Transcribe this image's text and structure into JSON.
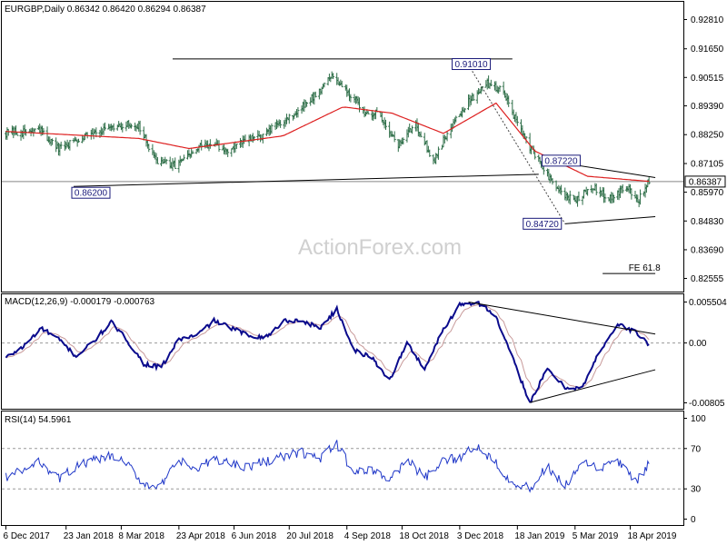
{
  "colors": {
    "price_bar": "#2f6f49",
    "ma": "#dd1f1f",
    "macd": "#0a0a8c",
    "signal": "#c89a9a",
    "rsi": "#1f37c8",
    "trendline": "#000000",
    "ref_dotted": "#888888",
    "grid": "#999999",
    "current_label_bg": "#ffffff"
  },
  "watermark": "ActionForex.com",
  "chart_data": [
    {
      "type": "candlestick",
      "header": "EURGBP,Daily  0.86342 0.86420 0.86294 0.86387",
      "y_ticks": [
        "0.92810",
        "0.91650",
        "0.90515",
        "0.89390",
        "0.88250",
        "0.87105",
        "0.85970",
        "0.84830",
        "0.83690",
        "0.82555"
      ],
      "current_price_label": "0.86387",
      "annotations": [
        {
          "text": "0.86200",
          "x": "2018-01-29",
          "price": 0.862
        },
        {
          "text": "0.91010",
          "x": "2018-12-10",
          "price": 0.9101
        },
        {
          "text": "0.87220",
          "x": "2019-02-11",
          "price": 0.8722
        },
        {
          "text": "0.84720",
          "x": "2019-02-25",
          "price": 0.8472
        },
        {
          "text": "FE 61.8",
          "x": "2019-04-08",
          "price": 0.8275
        }
      ],
      "anchor_points": [
        [
          "2017-12-06",
          0.8832
        ],
        [
          "2017-12-20",
          0.8835
        ],
        [
          "2018-01-03",
          0.884
        ],
        [
          "2018-01-17",
          0.8765
        ],
        [
          "2018-01-31",
          0.8805
        ],
        [
          "2018-02-14",
          0.884
        ],
        [
          "2018-02-28",
          0.8845
        ],
        [
          "2018-03-12",
          0.8865
        ],
        [
          "2018-03-22",
          0.886
        ],
        [
          "2018-04-03",
          0.873
        ],
        [
          "2018-04-18",
          0.87
        ],
        [
          "2018-04-30",
          0.8735
        ],
        [
          "2018-05-14",
          0.879
        ],
        [
          "2018-06-01",
          0.876
        ],
        [
          "2018-06-15",
          0.88
        ],
        [
          "2018-06-29",
          0.882
        ],
        [
          "2018-07-13",
          0.8875
        ],
        [
          "2018-07-27",
          0.8915
        ],
        [
          "2018-08-10",
          0.8985
        ],
        [
          "2018-08-24",
          0.906
        ],
        [
          "2018-09-03",
          0.9005
        ],
        [
          "2018-09-17",
          0.892
        ],
        [
          "2018-10-01",
          0.89
        ],
        [
          "2018-10-15",
          0.878
        ],
        [
          "2018-10-29",
          0.887
        ],
        [
          "2018-11-12",
          0.872
        ],
        [
          "2018-11-26",
          0.886
        ],
        [
          "2018-12-10",
          0.8955
        ],
        [
          "2018-12-24",
          0.903
        ],
        [
          "2019-01-07",
          0.9
        ],
        [
          "2019-01-21",
          0.8835
        ],
        [
          "2019-02-04",
          0.872
        ],
        [
          "2019-02-18",
          0.861
        ],
        [
          "2019-03-04",
          0.856
        ],
        [
          "2019-03-18",
          0.862
        ],
        [
          "2019-04-01",
          0.8575
        ],
        [
          "2019-04-15",
          0.862
        ],
        [
          "2019-04-24",
          0.856
        ],
        [
          "2019-05-03",
          0.8639
        ]
      ],
      "moving_average_anchors": [
        [
          "2017-12-06",
          0.8838
        ],
        [
          "2018-03-22",
          0.881
        ],
        [
          "2018-05-01",
          0.877
        ],
        [
          "2018-07-15",
          0.882
        ],
        [
          "2018-09-01",
          0.8935
        ],
        [
          "2018-10-10",
          0.891
        ],
        [
          "2018-11-20",
          0.883
        ],
        [
          "2019-01-01",
          0.895
        ],
        [
          "2019-02-01",
          0.876
        ],
        [
          "2019-03-15",
          0.866
        ],
        [
          "2019-05-03",
          0.864
        ]
      ],
      "trendlines": [
        {
          "from": [
            "2018-04-18",
            0.9125
          ],
          "to": [
            "2019-01-14",
            0.9125
          ]
        },
        {
          "from": [
            "2018-01-29",
            0.862
          ],
          "to": [
            "2019-02-04",
            0.8668
          ]
        },
        {
          "from": [
            "2019-02-11",
            0.8722
          ],
          "to": [
            "2019-05-08",
            0.8655
          ]
        },
        {
          "from": [
            "2019-02-25",
            0.8472
          ],
          "to": [
            "2019-05-08",
            0.85
          ]
        },
        {
          "from": [
            "2019-03-27",
            0.8275
          ],
          "to": [
            "2019-05-08",
            0.8275
          ]
        }
      ],
      "dotted_lines": [
        {
          "from": [
            "2018-12-10",
            0.9101
          ],
          "to": [
            "2019-02-25",
            0.8472
          ]
        },
        {
          "from": [
            "2017-12-01",
            0.8639
          ],
          "to": [
            "2019-05-08",
            0.8639
          ]
        }
      ]
    },
    {
      "type": "line",
      "header": "MACD(12,26,9) -0.000179 -0.000763",
      "y_ticks": [
        "0.005504",
        "0.00",
        "-0.00805"
      ],
      "macd_anchors": [
        [
          "2017-12-06",
          -0.002
        ],
        [
          "2017-12-20",
          -0.0005
        ],
        [
          "2018-01-03",
          0.002
        ],
        [
          "2018-01-17",
          0.0005
        ],
        [
          "2018-01-31",
          -0.0018
        ],
        [
          "2018-02-14",
          0.0002
        ],
        [
          "2018-02-28",
          0.0028
        ],
        [
          "2018-03-12",
          0.0005
        ],
        [
          "2018-03-26",
          -0.0028
        ],
        [
          "2018-04-09",
          -0.0033
        ],
        [
          "2018-04-23",
          0.0005
        ],
        [
          "2018-05-07",
          0.001
        ],
        [
          "2018-05-21",
          0.003
        ],
        [
          "2018-06-04",
          0.002
        ],
        [
          "2018-06-18",
          0.001
        ],
        [
          "2018-07-02",
          0.0008
        ],
        [
          "2018-07-16",
          0.003
        ],
        [
          "2018-07-30",
          0.003
        ],
        [
          "2018-08-13",
          0.002
        ],
        [
          "2018-08-27",
          0.0045
        ],
        [
          "2018-09-10",
          -0.001
        ],
        [
          "2018-09-24",
          -0.002
        ],
        [
          "2018-10-08",
          -0.005
        ],
        [
          "2018-10-22",
          0.0
        ],
        [
          "2018-11-05",
          -0.0035
        ],
        [
          "2018-11-19",
          0.0015
        ],
        [
          "2018-12-03",
          0.0052
        ],
        [
          "2018-12-17",
          0.0055
        ],
        [
          "2018-12-31",
          0.0038
        ],
        [
          "2019-01-14",
          -0.002
        ],
        [
          "2019-01-28",
          -0.008
        ],
        [
          "2019-02-11",
          -0.0035
        ],
        [
          "2019-02-25",
          -0.006
        ],
        [
          "2019-03-11",
          -0.006
        ],
        [
          "2019-03-25",
          -0.001
        ],
        [
          "2019-04-08",
          0.0025
        ],
        [
          "2019-04-22",
          0.0015
        ],
        [
          "2019-05-03",
          -0.0002
        ]
      ],
      "trendlines": [
        {
          "from": [
            "2018-12-10",
            0.0055
          ],
          "to": [
            "2019-05-08",
            0.0012
          ]
        },
        {
          "from": [
            "2019-01-28",
            -0.008
          ],
          "to": [
            "2019-05-08",
            -0.0036
          ]
        }
      ]
    },
    {
      "type": "line",
      "header": "RSI(14) 54.5961",
      "y_ticks": [
        "100",
        "70",
        "30",
        "0"
      ],
      "levels": [
        70,
        30
      ],
      "rsi_anchors": [
        [
          "2017-12-06",
          42
        ],
        [
          "2017-12-20",
          48
        ],
        [
          "2018-01-03",
          57
        ],
        [
          "2018-01-17",
          40
        ],
        [
          "2018-01-31",
          52
        ],
        [
          "2018-02-14",
          58
        ],
        [
          "2018-02-28",
          62
        ],
        [
          "2018-03-12",
          55
        ],
        [
          "2018-03-26",
          35
        ],
        [
          "2018-04-09",
          33
        ],
        [
          "2018-04-23",
          58
        ],
        [
          "2018-05-07",
          48
        ],
        [
          "2018-05-21",
          60
        ],
        [
          "2018-06-04",
          55
        ],
        [
          "2018-06-18",
          52
        ],
        [
          "2018-07-02",
          58
        ],
        [
          "2018-07-16",
          62
        ],
        [
          "2018-07-30",
          66
        ],
        [
          "2018-08-13",
          60
        ],
        [
          "2018-08-27",
          74
        ],
        [
          "2018-09-10",
          45
        ],
        [
          "2018-09-24",
          50
        ],
        [
          "2018-10-08",
          38
        ],
        [
          "2018-10-22",
          60
        ],
        [
          "2018-11-05",
          40
        ],
        [
          "2018-11-19",
          56
        ],
        [
          "2018-12-03",
          62
        ],
        [
          "2018-12-17",
          72
        ],
        [
          "2018-12-31",
          58
        ],
        [
          "2019-01-14",
          36
        ],
        [
          "2019-01-28",
          30
        ],
        [
          "2019-02-11",
          52
        ],
        [
          "2019-02-25",
          32
        ],
        [
          "2019-03-11",
          55
        ],
        [
          "2019-03-25",
          50
        ],
        [
          "2019-04-08",
          58
        ],
        [
          "2019-04-22",
          36
        ],
        [
          "2019-05-03",
          54.6
        ]
      ]
    }
  ],
  "x_axis_labels": [
    "6 Dec 2017",
    "23 Jan 2018",
    "8 Mar 2018",
    "23 Apr 2018",
    "6 Jun 2018",
    "20 Jul 2018",
    "4 Sep 2018",
    "18 Oct 2018",
    "3 Dec 2018",
    "18 Jan 2019",
    "5 Mar 2019",
    "18 Apr 2019"
  ]
}
